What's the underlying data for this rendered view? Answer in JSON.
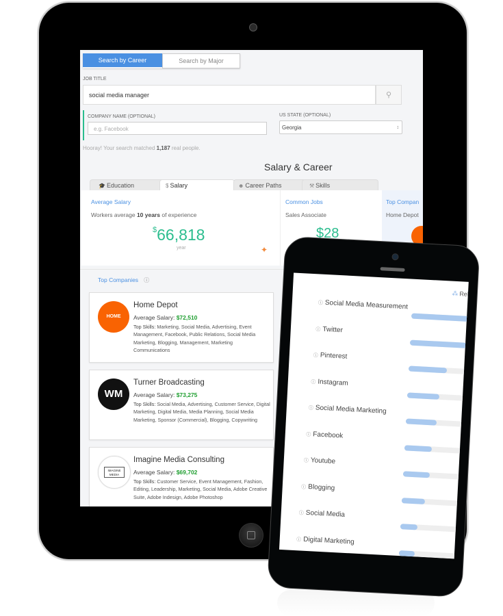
{
  "tablet": {
    "search_tabs": [
      {
        "label": "Search by Career",
        "active": true
      },
      {
        "label": "Search by Major",
        "active": false
      }
    ],
    "job_title_label": "JOB TITLE",
    "job_title_value": "social media manager",
    "search_icon": "magnifier-icon",
    "company_label": "COMPANY NAME (OPTIONAL)",
    "company_placeholder": "e.g. Facebook",
    "state_label": "US STATE (OPTIONAL)",
    "state_value": "Georgia",
    "match_prefix": "Hooray! Your search matched ",
    "match_count": "1,187",
    "match_suffix": " real people.",
    "section_title": "Salary & Career",
    "tabs": [
      {
        "icon": "graduation-cap-icon",
        "glyph": "🎓",
        "label": "Education"
      },
      {
        "icon": "dollar-icon",
        "glyph": "$",
        "label": "Salary"
      },
      {
        "icon": "person-icon",
        "glyph": "👤",
        "label": "Career Paths"
      },
      {
        "icon": "wrench-icon",
        "glyph": "🔧",
        "label": "Skills"
      }
    ],
    "avg_salary": {
      "title": "Average Salary",
      "desc_prefix": "Workers average ",
      "desc_bold": "10 years",
      "desc_suffix": " of experience",
      "currency": "$",
      "value": "66,818",
      "unit": "year"
    },
    "common_jobs": {
      "title": "Common Jobs",
      "job": "Sales Associate",
      "value_partial": "$28"
    },
    "top_companies_panel": {
      "title": "Top Compan",
      "company": "Home Depot"
    },
    "top_companies": {
      "title": "Top Companies",
      "info_glyph": "ⓘ",
      "items": [
        {
          "name": "Home Depot",
          "logo_text": "THE HOME DEPOT",
          "salary_label": "Average Salary: ",
          "salary": "$72,510",
          "skills_label": "Top Skills: ",
          "skills": "Marketing, Social Media, Advertising, Event Management, Facebook, Public Relations, Social Media Marketing, Blogging, Management, Marketing Communications"
        },
        {
          "name": "Turner Broadcasting",
          "logo_text": "WM",
          "salary_label": "Average Salary: ",
          "salary": "$73,275",
          "skills_label": "Top Skills: ",
          "skills": "Social Media, Advertising, Customer Service, Digital Marketing, Digital Media, Media Planning, Social Media Marketing, Sponsor (Commercial), Blogging, Copywriting"
        },
        {
          "name": "Imagine Media Consulting",
          "logo_text": "IMAGINE MEDIA",
          "salary_label": "Average Salary: ",
          "salary": "$69,702",
          "skills_label": "Top Skills: ",
          "skills": "Customer Service, Event Management, Fashion, Editing, Leadership, Marketing, Social Media, Adobe Creative Suite, Adobe Indesign, Adobe Photoshop"
        }
      ]
    }
  },
  "phone": {
    "relevance_label": "Rele",
    "relevance_glyph": "⁂",
    "info_glyph": "ⓘ",
    "skills": [
      {
        "name": "Social Media Measurement",
        "relevance": 0.95
      },
      {
        "name": "Twitter",
        "relevance": 0.92
      },
      {
        "name": "Pinterest",
        "relevance": 0.62
      },
      {
        "name": "Instagram",
        "relevance": 0.52
      },
      {
        "name": "Social Media Marketing",
        "relevance": 0.5
      },
      {
        "name": "Facebook",
        "relevance": 0.44
      },
      {
        "name": "Youtube",
        "relevance": 0.43
      },
      {
        "name": "Blogging",
        "relevance": 0.38
      },
      {
        "name": "Social Media",
        "relevance": 0.28
      },
      {
        "name": "Digital Marketing",
        "relevance": 0.25
      }
    ]
  },
  "colors": {
    "accent_blue": "#4a90e2",
    "salary_green": "#2bbd8e",
    "company_salary_green": "#1e9e2f",
    "bar_blue": "#a9c9ef",
    "home_depot_orange": "#f96302"
  }
}
